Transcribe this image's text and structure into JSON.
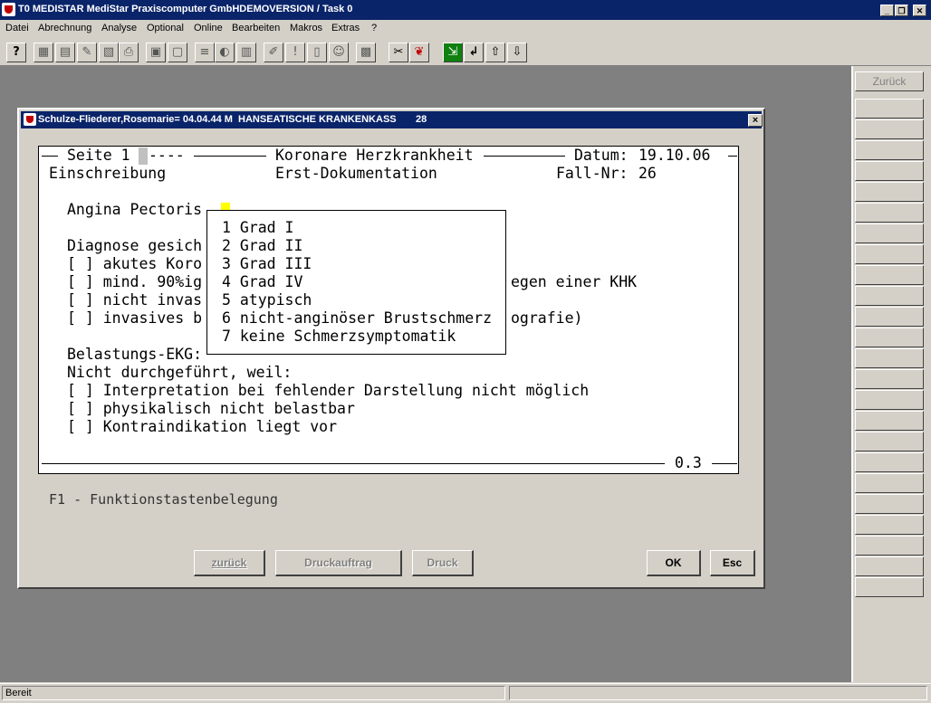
{
  "window": {
    "title": "T0 MEDISTAR MediStar Praxiscomputer GmbHDEMOVERSION / Task 0",
    "controls": [
      "minimize",
      "restore",
      "close"
    ]
  },
  "menu": [
    "Datei",
    "Abrechnung",
    "Analyse",
    "Optional",
    "Online",
    "Bearbeiten",
    "Makros",
    "Extras",
    "?"
  ],
  "toolbar": {
    "icons": [
      "help-icon",
      "tool1-icon",
      "tool2-icon",
      "tool3-icon",
      "tool4-icon",
      "print-icon",
      "save-icon",
      "doc-icon",
      "list-icon",
      "chart-icon",
      "grid-icon",
      "pen-icon",
      "exclaim-icon",
      "book-icon",
      "user-icon",
      "calc-icon",
      "scissors-icon",
      "copy-icon",
      "exit-icon",
      "enter-icon",
      "up-arrow-icon",
      "down-arrow-icon"
    ]
  },
  "side": {
    "zuruck": "Zurück"
  },
  "dialog": {
    "title": "Schulze-Fliederer,Rosemarie= 04.04.44 M  HANSEATISCHE KRANKENKASS       28",
    "close": "×"
  },
  "form": {
    "page": "Seite 1",
    "title": "Koronare Herzkrankheit",
    "datum_label": "Datum:",
    "datum": "19.10.06",
    "sub_left": "Einschreibung",
    "sub_mid": "Erst-Dokumentation",
    "fall_label": "Fall-Nr:",
    "fall": "26",
    "angina": "Angina Pectoris",
    "diag": "Diagnose gesich",
    "line1": "[ ] akutes Koro",
    "line2": "[ ] mind. 90%ig",
    "line2b": "egen einer KHK",
    "line3": "[ ] nicht invas",
    "line4": "[ ] invasives b",
    "line4b": "ografie)",
    "bel": "Belastungs-EKG:",
    "nicht": "Nicht durchgeführt, weil:",
    "opt1": "[ ] Interpretation bei fehlender Darstellung nicht möglich",
    "opt2": "[ ] physikalisch nicht belastbar",
    "opt3": "[ ] Kontraindikation liegt vor",
    "version": "0.3",
    "f1": "F1 - Funktionstastenbelegung"
  },
  "popup": {
    "items": [
      "1 Grad I",
      "2 Grad II",
      "3 Grad III",
      "4 Grad IV",
      "5 atypisch",
      "6 nicht-anginöser Brustschmerz",
      "7 keine Schmerzsymptomatik"
    ]
  },
  "buttons": {
    "zuruck": "zurück",
    "druckauftrag": "Druckauftrag",
    "druck": "Druck",
    "ok": "OK",
    "esc": "Esc"
  },
  "status": {
    "text": "Bereit"
  }
}
